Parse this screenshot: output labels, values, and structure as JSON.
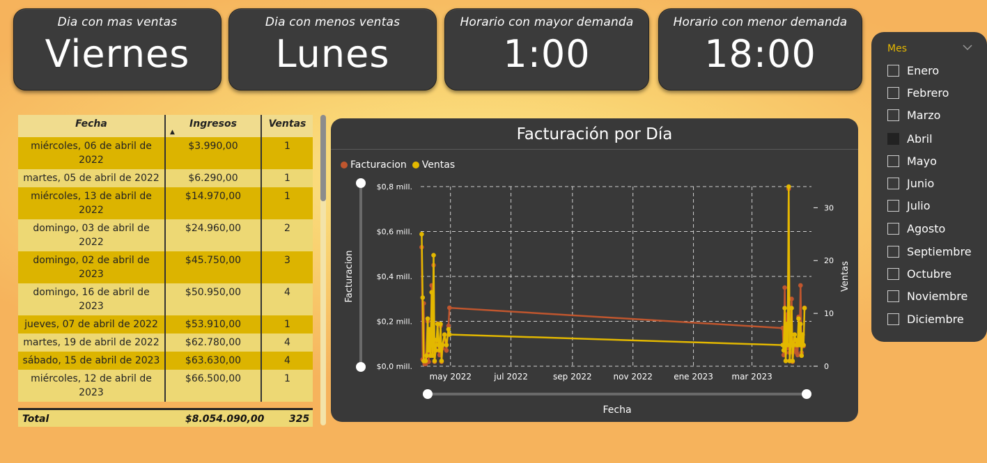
{
  "kpis": [
    {
      "title": "Dia con mas ventas",
      "value": "Viernes"
    },
    {
      "title": "Dia con menos ventas",
      "value": "Lunes"
    },
    {
      "title": "Horario con mayor demanda",
      "value": "1:00"
    },
    {
      "title": "Horario con menor demanda",
      "value": "18:00"
    }
  ],
  "table": {
    "headers": {
      "fecha": "Fecha",
      "ingresos": "Ingresos",
      "ventas": "Ventas"
    },
    "rows": [
      {
        "fecha": "miércoles, 06 de abril de 2022",
        "ingresos": "$3.990,00",
        "ventas": "1"
      },
      {
        "fecha": "martes, 05 de abril de 2022",
        "ingresos": "$6.290,00",
        "ventas": "1"
      },
      {
        "fecha": "miércoles, 13 de abril de 2022",
        "ingresos": "$14.970,00",
        "ventas": "1"
      },
      {
        "fecha": "domingo, 03 de abril de 2022",
        "ingresos": "$24.960,00",
        "ventas": "2"
      },
      {
        "fecha": "domingo, 02 de abril de 2023",
        "ingresos": "$45.750,00",
        "ventas": "3"
      },
      {
        "fecha": "domingo, 16 de abril de 2023",
        "ingresos": "$50.950,00",
        "ventas": "4"
      },
      {
        "fecha": "jueves, 07 de abril de 2022",
        "ingresos": "$53.910,00",
        "ventas": "1"
      },
      {
        "fecha": "martes, 19 de abril de 2022",
        "ingresos": "$62.780,00",
        "ventas": "4"
      },
      {
        "fecha": "sábado, 15 de abril de 2023",
        "ingresos": "$63.630,00",
        "ventas": "4"
      },
      {
        "fecha": "miércoles, 12 de abril de 2023",
        "ingresos": "$66.500,00",
        "ventas": "1"
      }
    ],
    "total": {
      "label": "Total",
      "ingresos": "$8.054.090,00",
      "ventas": "325"
    }
  },
  "chart": {
    "title": "Facturación por Día",
    "legend": [
      {
        "name": "Facturacion",
        "color": "#c0562e"
      },
      {
        "name": "Ventas",
        "color": "#e3b800"
      }
    ]
  },
  "chart_data": {
    "type": "line",
    "title": "Facturación por Día",
    "xlabel": "Fecha",
    "ylabel": "Facturacion",
    "y2label": "Ventas",
    "x_ticks": [
      "may 2022",
      "jul 2022",
      "sep 2022",
      "nov 2022",
      "ene 2023",
      "mar 2023"
    ],
    "y_ticks": [
      "$0,0 mill.",
      "$0,2 mill.",
      "$0,4 mill.",
      "$0,6 mill.",
      "$0,8 mill."
    ],
    "y2_ticks": [
      "0",
      "10",
      "20",
      "30"
    ],
    "ylim": [
      0,
      0.8
    ],
    "y2lim": [
      0,
      34
    ],
    "xlim": [
      "2022-04-01",
      "2023-04-30"
    ],
    "grid": true,
    "legend_position": "top-left",
    "series": [
      {
        "name": "Facturacion",
        "axis": "left",
        "color": "#c0562e",
        "x": [
          "2022-04-02",
          "2022-04-03",
          "2022-04-04",
          "2022-04-05",
          "2022-04-06",
          "2022-04-07",
          "2022-04-08",
          "2022-04-09",
          "2022-04-10",
          "2022-04-11",
          "2022-04-12",
          "2022-04-13",
          "2022-04-14",
          "2022-04-15",
          "2022-04-16",
          "2022-04-17",
          "2022-04-18",
          "2022-04-19",
          "2022-04-20",
          "2022-04-21",
          "2022-04-22",
          "2022-04-23",
          "2022-04-25",
          "2022-04-27",
          "2022-04-29",
          "2022-04-30",
          "2023-04-01",
          "2023-04-02",
          "2023-04-03",
          "2023-04-04",
          "2023-04-05",
          "2023-04-06",
          "2023-04-07",
          "2023-04-08",
          "2023-04-09",
          "2023-04-10",
          "2023-04-11",
          "2023-04-12",
          "2023-04-13",
          "2023-04-14",
          "2023-04-15",
          "2023-04-16",
          "2023-04-17",
          "2023-04-18",
          "2023-04-19",
          "2023-04-20",
          "2023-04-21",
          "2023-04-22",
          "2023-04-23"
        ],
        "y": [
          0.53,
          0.03,
          0.28,
          0.01,
          0.01,
          0.05,
          0.2,
          0.02,
          0.14,
          0.05,
          0.36,
          0.07,
          0.45,
          0.02,
          0.07,
          0.1,
          0.19,
          0.07,
          0.05,
          0.18,
          0.02,
          0.08,
          0.14,
          0.07,
          0.18,
          0.26,
          0.17,
          0.05,
          0.35,
          0.06,
          0.23,
          0.08,
          0.79,
          0.06,
          0.18,
          0.3,
          0.02,
          0.07,
          0.12,
          0.09,
          0.06,
          0.05,
          0.22,
          0.1,
          0.36,
          0.06,
          0.14,
          0.09,
          0.26
        ]
      },
      {
        "name": "Ventas",
        "axis": "right",
        "color": "#e3b800",
        "x": [
          "2022-04-02",
          "2022-04-03",
          "2022-04-04",
          "2022-04-05",
          "2022-04-06",
          "2022-04-07",
          "2022-04-08",
          "2022-04-09",
          "2022-04-10",
          "2022-04-11",
          "2022-04-12",
          "2022-04-13",
          "2022-04-14",
          "2022-04-15",
          "2022-04-16",
          "2022-04-17",
          "2022-04-18",
          "2022-04-19",
          "2022-04-20",
          "2022-04-21",
          "2022-04-22",
          "2022-04-23",
          "2022-04-25",
          "2022-04-27",
          "2022-04-29",
          "2022-04-30",
          "2023-04-01",
          "2023-04-02",
          "2023-04-03",
          "2023-04-04",
          "2023-04-05",
          "2023-04-06",
          "2023-04-07",
          "2023-04-08",
          "2023-04-09",
          "2023-04-10",
          "2023-04-11",
          "2023-04-12",
          "2023-04-13",
          "2023-04-14",
          "2023-04-15",
          "2023-04-16",
          "2023-04-17",
          "2023-04-18",
          "2023-04-19",
          "2023-04-20",
          "2023-04-21",
          "2023-04-22",
          "2023-04-23"
        ],
        "y": [
          25,
          13,
          1,
          1,
          1,
          2,
          9,
          3,
          7,
          2,
          14,
          2,
          21,
          1,
          3,
          5,
          8,
          4,
          3,
          8,
          1,
          4,
          6,
          4,
          7,
          6,
          4,
          3,
          11,
          1,
          8,
          4,
          34,
          1,
          4,
          11,
          1,
          4,
          6,
          5,
          4,
          4,
          9,
          4,
          8,
          2,
          6,
          4,
          11
        ]
      }
    ]
  },
  "slicer": {
    "title": "Mes",
    "items": [
      {
        "label": "Enero",
        "checked": false
      },
      {
        "label": "Febrero",
        "checked": false
      },
      {
        "label": "Marzo",
        "checked": false
      },
      {
        "label": "Abril",
        "checked": true
      },
      {
        "label": "Mayo",
        "checked": false
      },
      {
        "label": "Junio",
        "checked": false
      },
      {
        "label": "Julio",
        "checked": false
      },
      {
        "label": "Agosto",
        "checked": false
      },
      {
        "label": "Septiembre",
        "checked": false
      },
      {
        "label": "Octubre",
        "checked": false
      },
      {
        "label": "Noviembre",
        "checked": false
      },
      {
        "label": "Diciembre",
        "checked": false
      }
    ]
  }
}
